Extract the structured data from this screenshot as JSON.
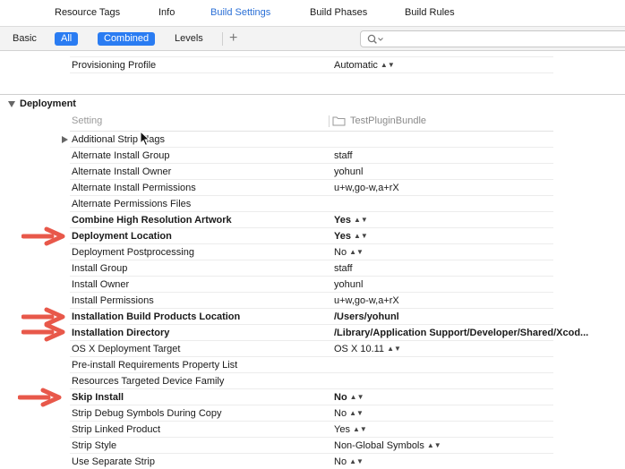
{
  "tabs": [
    "Resource Tags",
    "Info",
    "Build Settings",
    "Build Phases",
    "Build Rules"
  ],
  "filter": {
    "basic": "Basic",
    "all": "All",
    "combined": "Combined",
    "levels": "Levels",
    "add": "+"
  },
  "search": {
    "placeholder": ""
  },
  "top_row": {
    "label": "Provisioning Profile",
    "value": "Automatic"
  },
  "section": {
    "title": "Deployment"
  },
  "columns": {
    "setting": "Setting",
    "target": "TestPluginBundle"
  },
  "rows": [
    {
      "label": "Additional Strip Flags",
      "value": ""
    },
    {
      "label": "Alternate Install Group",
      "value": "staff"
    },
    {
      "label": "Alternate Install Owner",
      "value": "yohunl"
    },
    {
      "label": "Alternate Install Permissions",
      "value": "u+w,go-w,a+rX"
    },
    {
      "label": "Alternate Permissions Files",
      "value": ""
    },
    {
      "label": "Combine High Resolution Artwork",
      "value": "Yes"
    },
    {
      "label": "Deployment Location",
      "value": "Yes"
    },
    {
      "label": "Deployment Postprocessing",
      "value": "No"
    },
    {
      "label": "Install Group",
      "value": "staff"
    },
    {
      "label": "Install Owner",
      "value": "yohunl"
    },
    {
      "label": "Install Permissions",
      "value": "u+w,go-w,a+rX"
    },
    {
      "label": "Installation Build Products Location",
      "value": "/Users/yohunl"
    },
    {
      "label": "Installation Directory",
      "value": "/Library/Application Support/Developer/Shared/Xcod..."
    },
    {
      "label": "OS X Deployment Target",
      "value": "OS X 10.11"
    },
    {
      "label": "Pre-install Requirements Property List",
      "value": ""
    },
    {
      "label": "Resources Targeted Device Family",
      "value": ""
    },
    {
      "label": "Skip Install",
      "value": "No"
    },
    {
      "label": "Strip Debug Symbols During Copy",
      "value": "No"
    },
    {
      "label": "Strip Linked Product",
      "value": "Yes"
    },
    {
      "label": "Strip Style",
      "value": "Non-Global Symbols"
    },
    {
      "label": "Use Separate Strip",
      "value": "No"
    }
  ],
  "colors": {
    "accent": "#2a7cf2",
    "tab_active": "#2a6fd6",
    "arrow": "#e8584a"
  },
  "icons": [
    "search-icon",
    "chevron-down-icon",
    "folder-icon",
    "disclosure-triangle-icon",
    "updown-arrows-icon",
    "red-arrow-annotation",
    "mouse-cursor"
  ]
}
